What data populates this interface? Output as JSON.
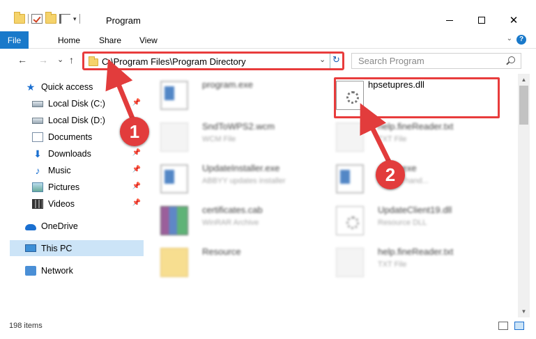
{
  "window": {
    "title": "Program",
    "minimize_glyph": "",
    "maximize_glyph": "",
    "close_glyph": "✕"
  },
  "ribbon": {
    "tabs": [
      "File",
      "Home",
      "Share",
      "View"
    ],
    "help": "?"
  },
  "address": {
    "path": "C:\\Program Files\\Program Directory",
    "search_placeholder": "Search Program"
  },
  "nav": {
    "back": "←",
    "forward": "→",
    "recent": "⌄",
    "up": "↑"
  },
  "sidebar": {
    "items": [
      {
        "label": "Quick access",
        "icon": "star-icon",
        "pinned": false
      },
      {
        "label": "Local Disk (C:)",
        "icon": "disk-icon",
        "pinned": true
      },
      {
        "label": "Local Disk (D:)",
        "icon": "disk-icon",
        "pinned": false
      },
      {
        "label": "Documents",
        "icon": "documents-icon",
        "pinned": true
      },
      {
        "label": "Downloads",
        "icon": "download-icon",
        "pinned": true
      },
      {
        "label": "Music",
        "icon": "music-icon",
        "pinned": true
      },
      {
        "label": "Pictures",
        "icon": "pictures-icon",
        "pinned": true
      },
      {
        "label": "Videos",
        "icon": "videos-icon",
        "pinned": true
      },
      {
        "label": "OneDrive",
        "icon": "onedrive-icon",
        "pinned": false
      },
      {
        "label": "This PC",
        "icon": "this-pc-icon",
        "pinned": false,
        "selected": true
      },
      {
        "label": "Network",
        "icon": "network-icon",
        "pinned": false
      }
    ]
  },
  "files": [
    {
      "name": "program.exe",
      "type": "",
      "icon": "program-icon",
      "blurred": true
    },
    {
      "name": "hpsetupres.dll",
      "type": "",
      "icon": "dll-icon",
      "blurred": false,
      "highlighted": true
    },
    {
      "name": "SndToWPS2.wcm",
      "type": "WCM File",
      "icon": "file-icon",
      "blurred": true
    },
    {
      "name": "help.fineReader.txt",
      "type": "TXT File",
      "icon": "text-file-icon",
      "blurred": true
    },
    {
      "name": "UpdateInstaller.exe",
      "type": "ABBYY updates installer",
      "icon": "exe-icon",
      "blurred": true
    },
    {
      "name": "...STI.exe",
      "type": "...event hand...",
      "icon": "exe-icon",
      "blurred": true
    },
    {
      "name": "certificates.cab",
      "type": "WinRAR Archive",
      "icon": "archive-icon",
      "blurred": true
    },
    {
      "name": "UpdateClient19.dll",
      "type": "Resource DLL",
      "icon": "dll-icon",
      "blurred": true
    },
    {
      "name": "Resource",
      "type": "",
      "icon": "folder-icon",
      "blurred": true
    },
    {
      "name": "help.fineReader.txt",
      "type": "TXT File",
      "icon": "text-file-icon",
      "blurred": true
    }
  ],
  "status": {
    "item_count": "198 items"
  },
  "annotations": {
    "step1": "1",
    "step2": "2",
    "color": "#e23c3c"
  },
  "colors": {
    "accent": "#1979ca",
    "highlight": "#e83c3c",
    "selected": "#cce4f7"
  }
}
